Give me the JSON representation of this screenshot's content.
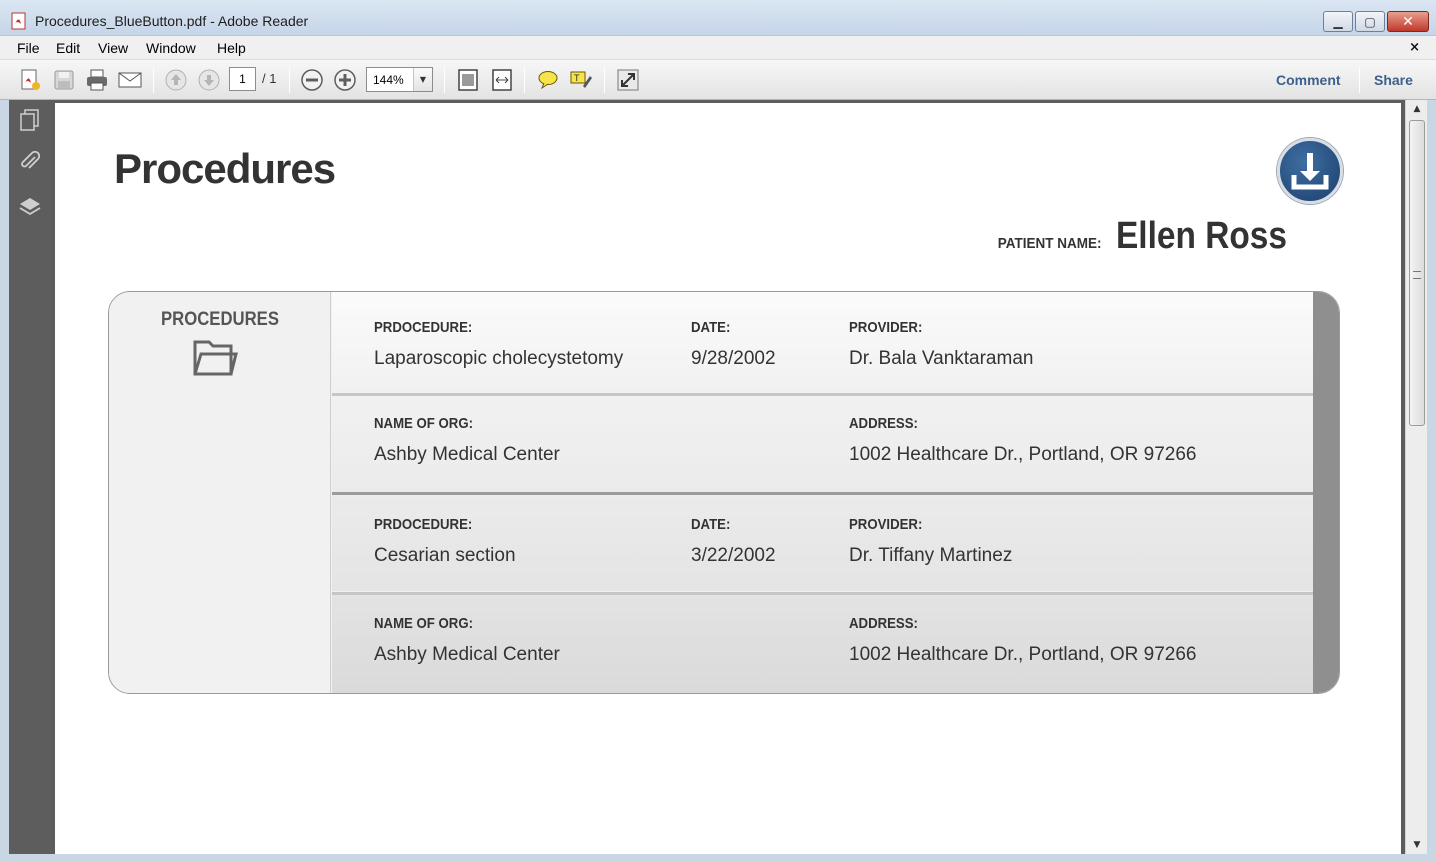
{
  "window": {
    "title": "Procedures_BlueButton.pdf - Adobe Reader",
    "minimize": "▁",
    "maximize": "▢",
    "close": "✕"
  },
  "menu": {
    "items": [
      "File",
      "Edit",
      "View",
      "Window",
      "Help"
    ],
    "close_doc": "×"
  },
  "toolbar": {
    "page_number": "1",
    "page_total": "/ 1",
    "zoom": "144%",
    "comment_label": "Comment",
    "share_label": "Share"
  },
  "document": {
    "title": "Procedures",
    "patient_label": "PATIENT NAME:",
    "patient_name": "Ellen Ross",
    "section_title": "PROCEDURES",
    "procedures": [
      {
        "procedure_label": "PRDOCEDURE:",
        "procedure": "Laparoscopic cholecystetomy",
        "date_label": "DATE:",
        "date": "9/28/2002",
        "provider_label": "PROVIDER:",
        "provider": "Dr. Bala Vanktaraman",
        "org_label": "NAME OF ORG:",
        "org": "Ashby Medical Center",
        "address_label": "ADDRESS:",
        "address": "1002 Healthcare Dr., Portland, OR 97266"
      },
      {
        "procedure_label": "PRDOCEDURE:",
        "procedure": "Cesarian section",
        "date_label": "DATE:",
        "date": "3/22/2002",
        "provider_label": "PROVIDER:",
        "provider": "Dr. Tiffany Martinez",
        "org_label": "NAME OF ORG:",
        "org": "Ashby Medical Center",
        "address_label": "ADDRESS:",
        "address": "1002 Healthcare Dr., Portland, OR 97266"
      }
    ]
  },
  "colors": {
    "accent_link": "#3d5f8c",
    "download_button": "#1b3f6b",
    "nav_panel": "#5d5d5d"
  }
}
